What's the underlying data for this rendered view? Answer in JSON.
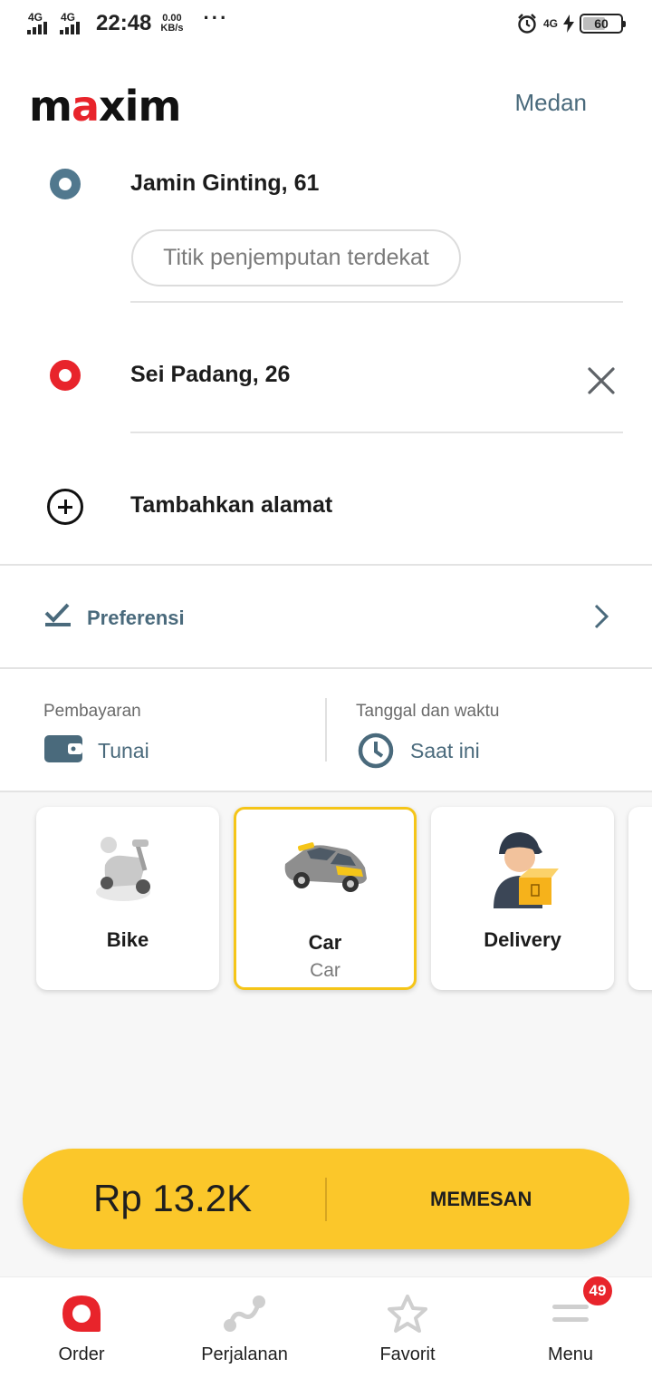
{
  "status_bar": {
    "network_1": "4G",
    "network_2": "4G",
    "time": "22:48",
    "speed_value": "0.00",
    "speed_unit": "KB/s",
    "more": "···",
    "right_network": "4G",
    "battery": "60",
    "battery_level": 0.6
  },
  "header": {
    "logo": "maxim",
    "city": "Medan"
  },
  "route": {
    "pickup_address": "Jamin Ginting, 61",
    "pickup_hint": "Titik penjemputan terdekat",
    "destination_address": "Sei Padang, 26",
    "add_address": "Tambahkan alamat"
  },
  "preferences": {
    "label": "Preferensi"
  },
  "payment": {
    "label": "Pembayaran",
    "value": "Tunai"
  },
  "schedule": {
    "label": "Tanggal dan waktu",
    "value": "Saat ini"
  },
  "services": [
    {
      "name": "Bike",
      "sub": ""
    },
    {
      "name": "Car",
      "sub": "Car",
      "selected": true
    },
    {
      "name": "Delivery",
      "sub": ""
    }
  ],
  "order": {
    "price": "Rp 13.2K",
    "button": "MEMESAN"
  },
  "bottom_nav": {
    "items": [
      {
        "label": "Order",
        "icon": "order-icon",
        "active": true
      },
      {
        "label": "Perjalanan",
        "icon": "trips-icon"
      },
      {
        "label": "Favorit",
        "icon": "star-icon"
      },
      {
        "label": "Menu",
        "icon": "menu-icon"
      }
    ],
    "menu_badge": "49"
  },
  "colors": {
    "accent_red": "#e8242b",
    "slate": "#4a6a7c",
    "yellow": "#fbc72a"
  }
}
